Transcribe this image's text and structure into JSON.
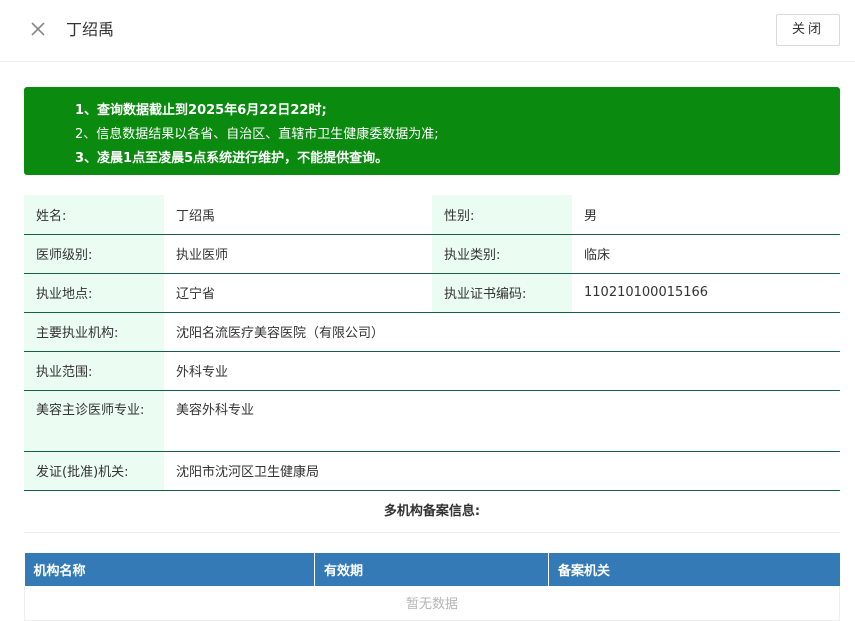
{
  "header": {
    "title": "丁绍禹",
    "close_label": "关闭"
  },
  "notice": {
    "lines": [
      "1、查询数据截止到2025年6月22日22时;",
      "2、信息数据结果以各省、自治区、直辖市卫生健康委数据为准;",
      "3、凌晨1点至凌晨5点系统进行维护，不能提供查询。"
    ]
  },
  "info": {
    "name_label": "姓名:",
    "name_value": "丁绍禹",
    "gender_label": "性别:",
    "gender_value": "男",
    "level_label": "医师级别:",
    "level_value": "执业医师",
    "category_label": "执业类别:",
    "category_value": "临床",
    "location_label": "执业地点:",
    "location_value": "辽宁省",
    "cert_label": "执业证书编码:",
    "cert_value": "110210100015166",
    "institution_label": "主要执业机构:",
    "institution_value": "沈阳名流医疗美容医院（有限公司）",
    "scope_label": "执业范围:",
    "scope_value": "外科专业",
    "cosmetic_label": "美容主诊医师专业:",
    "cosmetic_value": "美容外科专业",
    "issuer_label": "发证(批准)机关:",
    "issuer_value": "沈阳市沈河区卫生健康局"
  },
  "multi": {
    "title": "多机构备案信息:",
    "columns": [
      "机构名称",
      "有效期",
      "备案机关"
    ],
    "empty_text": "暂无数据"
  },
  "colors": {
    "notice_bg": "#0a8a0f",
    "label_bg": "#ebfcf2",
    "table_header_bg": "#337ab7",
    "row_border": "#14604a"
  }
}
